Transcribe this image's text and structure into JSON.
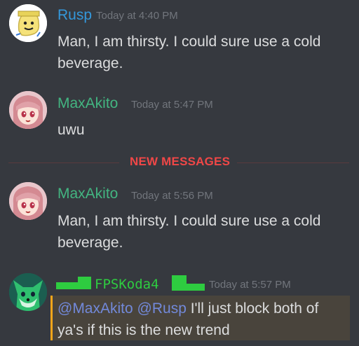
{
  "messages": [
    {
      "username": "Rusp",
      "username_color": "#3498db",
      "timestamp": "Today at 4:40 PM",
      "text": "Man, I am thirsty. I could sure use a cold beverage."
    },
    {
      "username": "MaxAkito",
      "username_color": "#43b581",
      "timestamp": "Today at 5:47 PM",
      "text": "uwu"
    },
    {
      "username": "MaxAkito",
      "username_color": "#43b581",
      "timestamp": "Today at 5:56 PM",
      "text": "Man, I am thirsty. I could sure use a cold beverage."
    },
    {
      "username": "FPSKoda4",
      "username_color": "#2ecc40",
      "timestamp": "Today at 5:57 PM",
      "mention_1": "@MaxAkito",
      "mention_2": "@Rusp",
      "text": " I'll just block both of ya's if this is the new trend"
    }
  ],
  "divider": {
    "label": "NEW MESSAGES"
  },
  "colors": {
    "background": "#36393f",
    "new_messages_red": "#f04747",
    "mention_blue": "#7289da",
    "mention_highlight_bar": "#faa61a"
  },
  "icons": {
    "avatar_1": "yellow-blob-face-avatar",
    "avatar_2": "anime-girl-avatar",
    "avatar_3": "anime-girl-avatar",
    "avatar_4": "green-fox-avatar"
  }
}
